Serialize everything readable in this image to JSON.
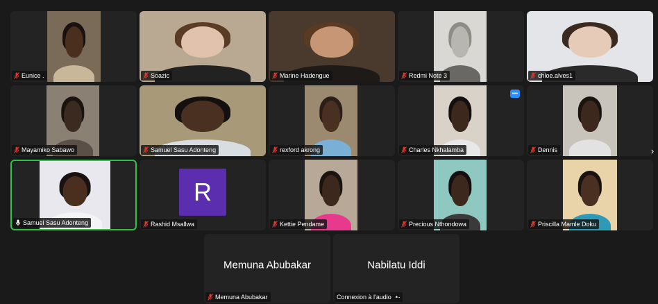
{
  "colors": {
    "background": "#1a1a1a",
    "tile": "#232323",
    "active_speaker": "#2ec24b",
    "muted_icon": "#e0362c",
    "accent": "#2d8cff"
  },
  "gallery": {
    "next_page_icon": "chevron-right-icon",
    "participants": [
      {
        "name": "Eunice .",
        "muted": true,
        "video": true,
        "bg": "#7a6a58",
        "skin": "#4a2e1e",
        "hair": "#1a1210",
        "shirt": "#c9b79a"
      },
      {
        "name": "Soazic",
        "muted": true,
        "video": true,
        "bg": "#b9a993",
        "skin": "#e0c2ad",
        "hair": "#5a3c26",
        "shirt": "#222222"
      },
      {
        "name": "Marine Hadengue",
        "muted": true,
        "video": true,
        "bg": "#4a3a2e",
        "skin": "#c69675",
        "hair": "#5a3a22",
        "shirt": "#1e1a18"
      },
      {
        "name": "Redmi Note 3",
        "muted": true,
        "video": true,
        "bg": "#d9d8d4",
        "skin": "#b8b6b0",
        "hair": "#8e8c86",
        "shirt": "#6a6864"
      },
      {
        "name": "chloe.alves1",
        "muted": true,
        "video": true,
        "bg": "#e3e5e8",
        "skin": "#e6cbb8",
        "hair": "#3a2a20",
        "shirt": "#2a2a2a"
      },
      {
        "name": "Mayamiko Sabawo",
        "muted": true,
        "video": true,
        "bg": "#8a8074",
        "skin": "#3a2a20",
        "hair": "#1a1410",
        "shirt": "#5a5048"
      },
      {
        "name": "Samuel Sasu Adonteng",
        "muted": true,
        "video": true,
        "bg": "#a89a78",
        "skin": "#4a3020",
        "hair": "#151010",
        "shirt": "#d8dde2"
      },
      {
        "name": "rexford akrong",
        "muted": true,
        "video": true,
        "bg": "#9c8a70",
        "skin": "#4a3020",
        "hair": "#2a1e18",
        "shirt": "#7ab0d8"
      },
      {
        "name": "Charles Nkhalamba",
        "muted": true,
        "video": true,
        "bg": "#d8d2c8",
        "skin": "#3c281c",
        "hair": "#141010",
        "shirt": "#e8e8e8"
      },
      {
        "name": "Dennis",
        "muted": true,
        "video": true,
        "bg": "#c8c4bc",
        "skin": "#3c281c",
        "hair": "#1a1410",
        "shirt": "#e2e2e2"
      },
      {
        "name": "Samuel Sasu Adonteng",
        "muted": false,
        "video": true,
        "active": true,
        "bg": "#e8e8ee",
        "skin": "#4a2e1e",
        "hair": "#1a1210",
        "shirt": "#f4f4f6"
      },
      {
        "name": "Rashid Msallwa",
        "muted": true,
        "video": false,
        "initial": "R",
        "avatar_color": "#5a2eae"
      },
      {
        "name": "Kettie Pendame",
        "muted": true,
        "video": true,
        "bg": "#b8a898",
        "skin": "#3c281c",
        "hair": "#1a1410",
        "shirt": "#e83a8c"
      },
      {
        "name": "Precious Nthondowa",
        "muted": true,
        "video": true,
        "bg": "#8ec8c0",
        "skin": "#3c281c",
        "hair": "#141010",
        "shirt": "#3a3a3a"
      },
      {
        "name": "Priscilla Mamle Doku",
        "muted": true,
        "video": true,
        "bg": "#e8d4a8",
        "skin": "#4a3020",
        "hair": "#1a1210",
        "shirt": "#2e9ab8"
      },
      {
        "name": "Memuna Abubakar",
        "muted": true,
        "video": false,
        "center_name": "Memuna Abubakar"
      },
      {
        "name": "Connexion à l'audio",
        "muted": false,
        "video": false,
        "center_name": "Nabilatu Iddi",
        "connecting": true
      }
    ]
  }
}
